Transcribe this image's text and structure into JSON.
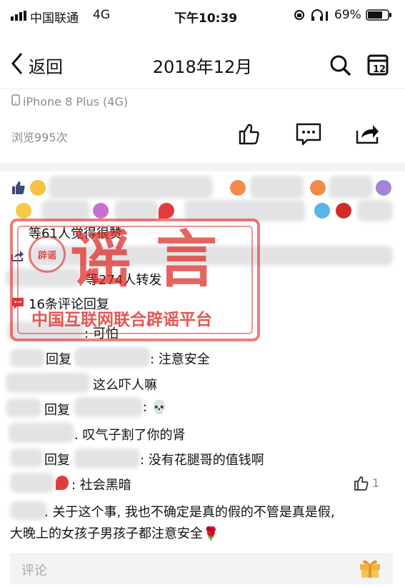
{
  "status_bar": {
    "carrier": "中国联通",
    "network": "4G",
    "time": "下午10:39",
    "battery": "69%"
  },
  "navbar": {
    "back_label": "返回",
    "title": "2018年12月"
  },
  "device_label": "iPhone 8 Plus (4G)",
  "views_text": "浏览995次",
  "likes_text": "等61人觉得很赞",
  "shares_text": "等274人转发",
  "comments_count_text": "16条评论回复",
  "stamp": {
    "badge": "辟谣",
    "title": "谣言",
    "org": "中国互联网联合辟谣平台"
  },
  "comments": [
    {
      "text": ": 可怕"
    },
    {
      "reply_label": "回复",
      "text": ": 注意安全"
    },
    {
      "text": "这么吓人嘛"
    },
    {
      "reply_label": "回复",
      "text": ": 💀"
    },
    {
      "text": ". 叹气子割了你的肾"
    },
    {
      "reply_label": "回复",
      "text": ": 没有花腿哥的值钱啊"
    },
    {
      "text": ": 社会黑暗",
      "likes": "1"
    },
    {
      "text": ". 关于这个事, 我也不确定是真的假的不管是真是假,",
      "text2": "大晚上的女孩子男孩子都注意安全🌹"
    }
  ],
  "comment_input": {
    "placeholder": "评论"
  },
  "colors": {
    "stamp_red": "#dc2823",
    "comment_icon": "#d9363e",
    "gift": "#f0b33c"
  }
}
